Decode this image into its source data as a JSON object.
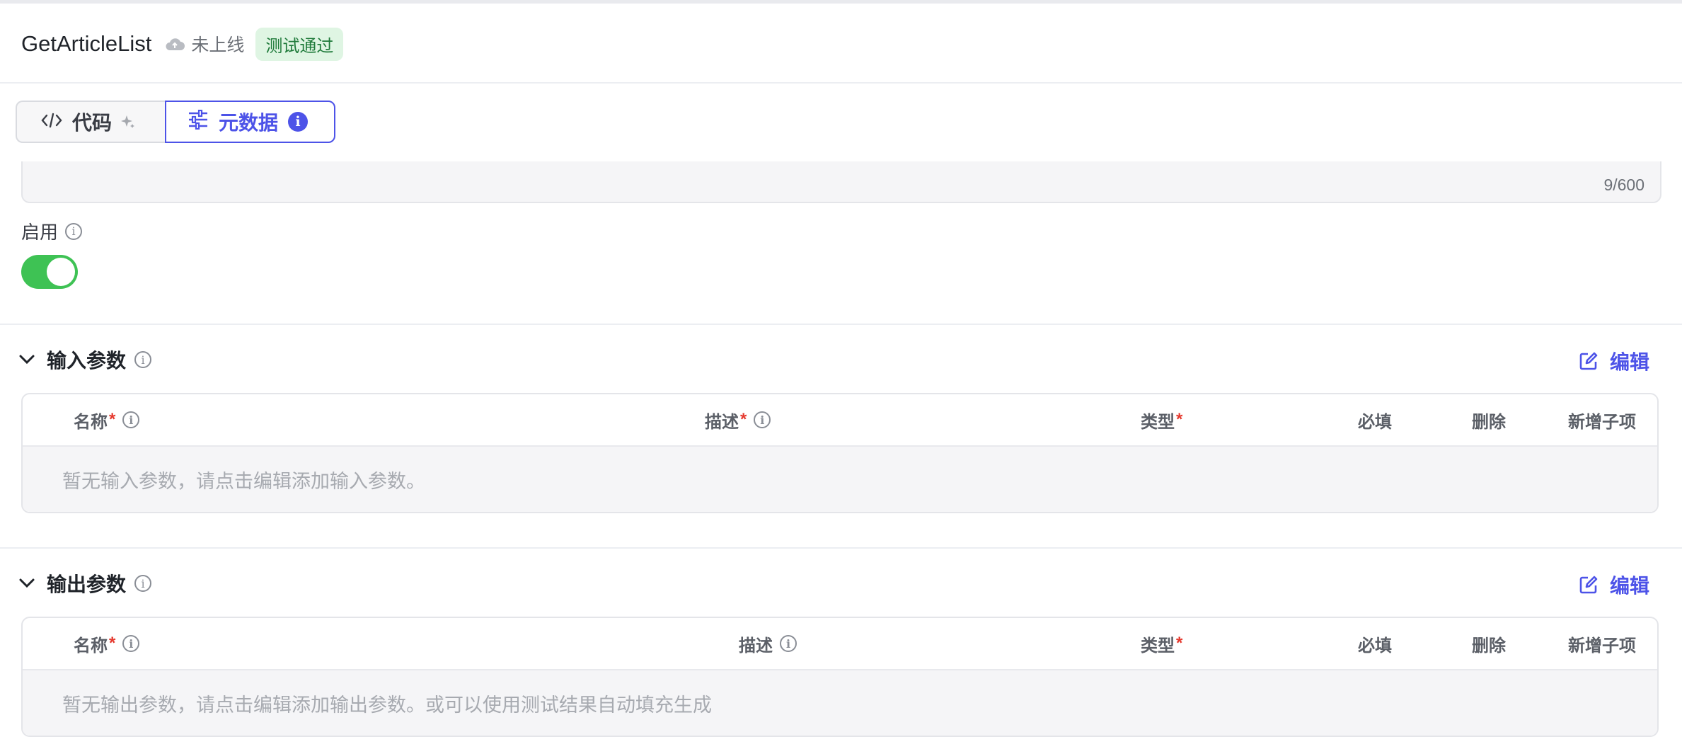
{
  "header": {
    "title": "GetArticleList",
    "status_icon": "cloud-icon",
    "status_text": "未上线",
    "badge": "测试通过"
  },
  "tabs": [
    {
      "label": "代码",
      "icon": "code-icon",
      "active": false
    },
    {
      "label": "元数据",
      "icon": "sliders-icon",
      "active": true,
      "info": "i"
    }
  ],
  "description": {
    "counter": "9/600"
  },
  "enable": {
    "label": "启用",
    "value": true
  },
  "input_params": {
    "title": "输入参数",
    "edit_label": "编辑",
    "columns": {
      "name": "名称",
      "desc": "描述",
      "type": "类型",
      "required": "必填",
      "delete": "删除",
      "add_child": "新增子项"
    },
    "required_mark": "*",
    "empty_text": "暂无输入参数，请点击编辑添加输入参数。"
  },
  "output_params": {
    "title": "输出参数",
    "edit_label": "编辑",
    "columns": {
      "name": "名称",
      "desc": "描述",
      "type": "类型",
      "required": "必填",
      "delete": "删除",
      "add_child": "新增子项"
    },
    "required_mark": "*",
    "empty_text": "暂无输出参数，请点击编辑添加输出参数。或可以使用测试结果自动填充生成"
  },
  "colors": {
    "accent": "#4d53e8",
    "toggle_on": "#3ec254",
    "badge_bg": "#dff5e3",
    "badge_text": "#1f7a3a",
    "required": "#e5392e"
  }
}
